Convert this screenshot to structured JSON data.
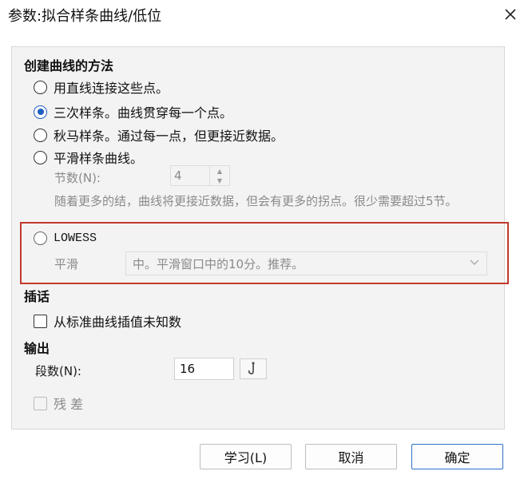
{
  "window": {
    "title": "参数:拟合样条曲线/低位"
  },
  "method": {
    "heading": "创建曲线的方法",
    "options": [
      {
        "label": "用直线连接这些点。",
        "checked": false
      },
      {
        "label": "三次样条。曲线贯穿每一个点。",
        "checked": true
      },
      {
        "label": "秋马样条。通过每一点，但更接近数据。",
        "checked": false
      },
      {
        "label": "平滑样条曲线。",
        "checked": false
      }
    ],
    "knots_label": "节数(N):",
    "knots_value": "4",
    "knots_hint": "随着更多的结，曲线将更接近数据，但会有更多的拐点。很少需要超过5节。",
    "lowess_label": "LOWESS",
    "smooth_label": "平滑",
    "smooth_value": "中。平滑窗口中的10分。推荐。"
  },
  "interpolation": {
    "heading": "插话",
    "checkbox_label": "从标准曲线插值未知数"
  },
  "output": {
    "heading": "输出",
    "segments_label": "段数(N):",
    "segments_value": "16",
    "residuals_label": "残 差"
  },
  "buttons": {
    "learn": "学习(L)",
    "cancel": "取消",
    "ok": "确定"
  },
  "colors": {
    "accent": "#1f5fbf",
    "highlight_box": "#c0392b"
  }
}
